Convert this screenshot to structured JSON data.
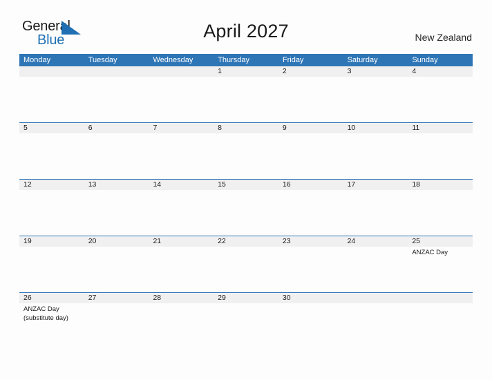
{
  "brand": {
    "name_part1": "General",
    "name_part2": "Blue",
    "color_dark": "#1a1a1a",
    "color_blue": "#1f6fb2",
    "triangle_icon": "triangle-flag-icon"
  },
  "header": {
    "title": "April 2027",
    "region": "New Zealand"
  },
  "theme": {
    "header_blue": "#2e75b6",
    "band_gray": "#f0f0f0",
    "page_background": "#fdfdfd",
    "text": "#1a1a1a"
  },
  "calendar": {
    "weekdays": [
      "Monday",
      "Tuesday",
      "Wednesday",
      "Thursday",
      "Friday",
      "Saturday",
      "Sunday"
    ],
    "weeks": [
      [
        {
          "day": "",
          "events": []
        },
        {
          "day": "",
          "events": []
        },
        {
          "day": "",
          "events": []
        },
        {
          "day": "1",
          "events": []
        },
        {
          "day": "2",
          "events": []
        },
        {
          "day": "3",
          "events": []
        },
        {
          "day": "4",
          "events": []
        }
      ],
      [
        {
          "day": "5",
          "events": []
        },
        {
          "day": "6",
          "events": []
        },
        {
          "day": "7",
          "events": []
        },
        {
          "day": "8",
          "events": []
        },
        {
          "day": "9",
          "events": []
        },
        {
          "day": "10",
          "events": []
        },
        {
          "day": "11",
          "events": []
        }
      ],
      [
        {
          "day": "12",
          "events": []
        },
        {
          "day": "13",
          "events": []
        },
        {
          "day": "14",
          "events": []
        },
        {
          "day": "15",
          "events": []
        },
        {
          "day": "16",
          "events": []
        },
        {
          "day": "17",
          "events": []
        },
        {
          "day": "18",
          "events": []
        }
      ],
      [
        {
          "day": "19",
          "events": []
        },
        {
          "day": "20",
          "events": []
        },
        {
          "day": "21",
          "events": []
        },
        {
          "day": "22",
          "events": []
        },
        {
          "day": "23",
          "events": []
        },
        {
          "day": "24",
          "events": []
        },
        {
          "day": "25",
          "events": [
            "ANZAC Day"
          ]
        }
      ],
      [
        {
          "day": "26",
          "events": [
            "ANZAC Day",
            "(substitute day)"
          ]
        },
        {
          "day": "27",
          "events": []
        },
        {
          "day": "28",
          "events": []
        },
        {
          "day": "29",
          "events": []
        },
        {
          "day": "30",
          "events": []
        },
        {
          "day": "",
          "events": []
        },
        {
          "day": "",
          "events": []
        }
      ]
    ]
  }
}
